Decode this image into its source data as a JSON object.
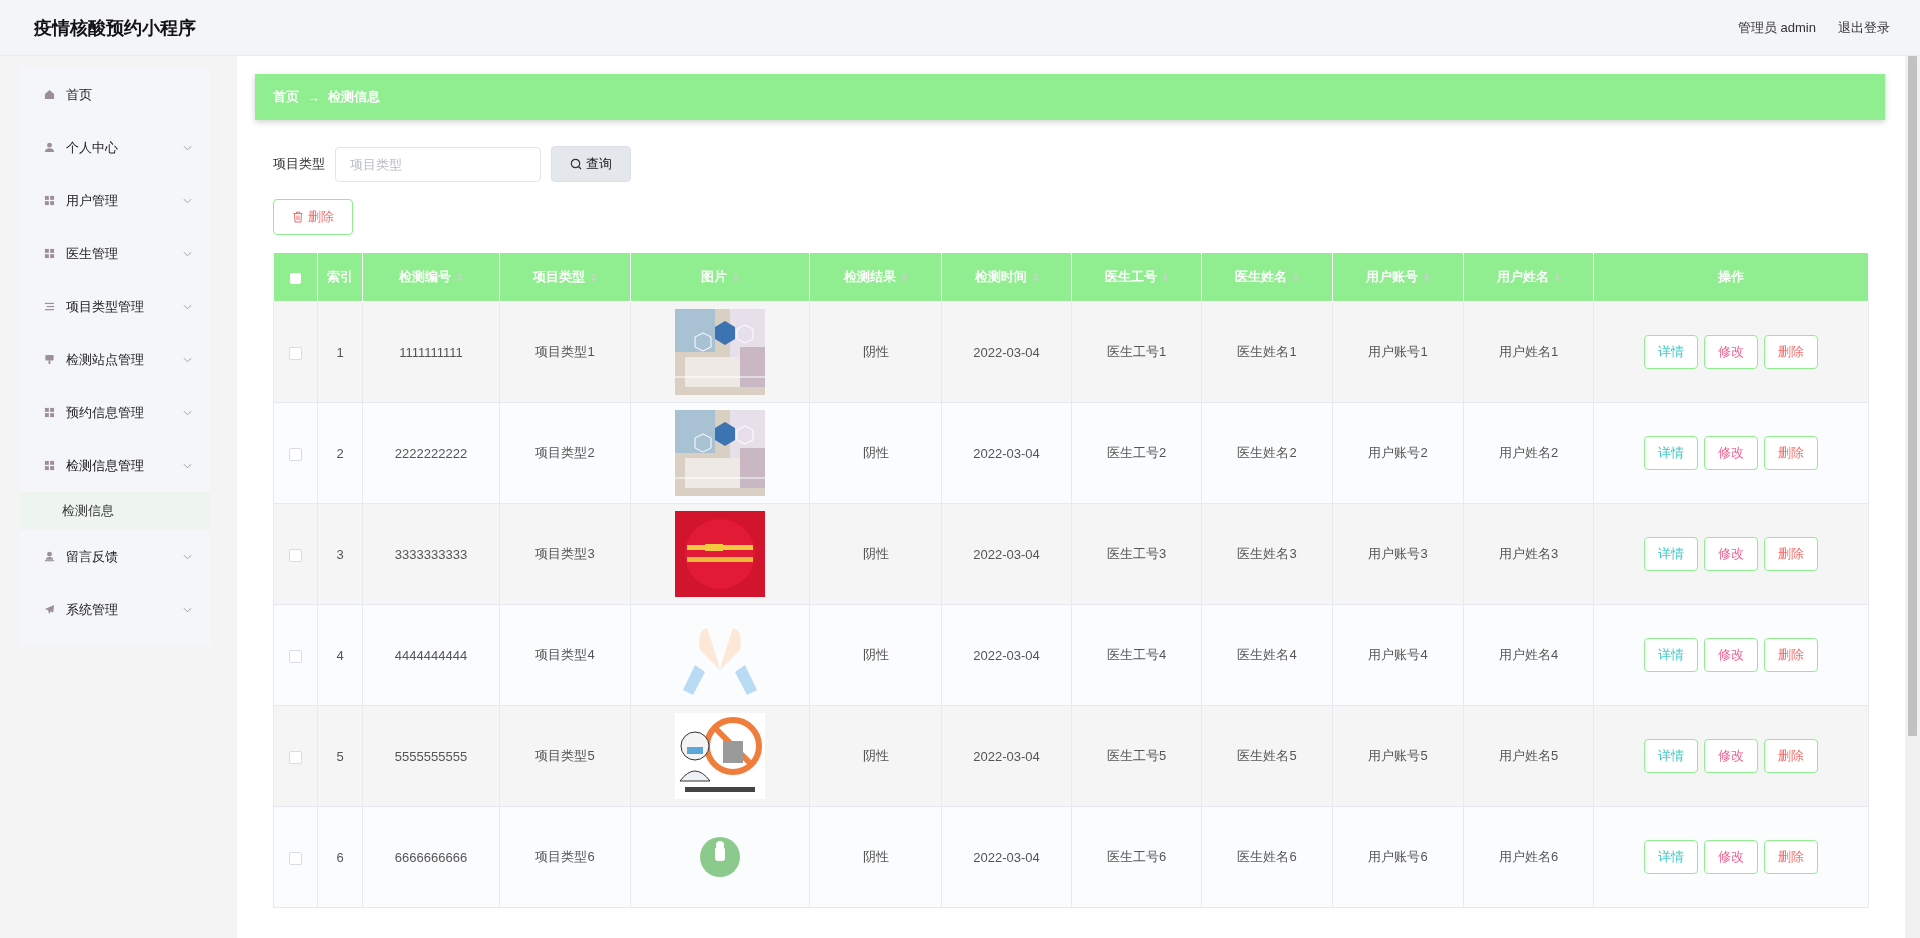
{
  "header": {
    "title": "疫情核酸预约小程序",
    "user": "管理员 admin",
    "logout": "退出登录"
  },
  "sidebar": {
    "items": [
      {
        "label": "首页",
        "kind": "link",
        "expanded": false
      },
      {
        "label": "个人中心",
        "kind": "submenu",
        "expanded": false
      },
      {
        "label": "用户管理",
        "kind": "submenu",
        "expanded": false
      },
      {
        "label": "医生管理",
        "kind": "submenu",
        "expanded": false
      },
      {
        "label": "项目类型管理",
        "kind": "submenu",
        "expanded": false
      },
      {
        "label": "检测站点管理",
        "kind": "submenu",
        "expanded": false
      },
      {
        "label": "预约信息管理",
        "kind": "submenu",
        "expanded": false
      },
      {
        "label": "检测信息管理",
        "kind": "submenu",
        "expanded": true,
        "children": [
          {
            "label": "检测信息",
            "selected": true
          }
        ]
      },
      {
        "label": "留言反馈",
        "kind": "submenu",
        "expanded": false
      },
      {
        "label": "系统管理",
        "kind": "submenu",
        "expanded": false
      }
    ]
  },
  "breadcrumb": [
    "首页",
    "→",
    "检测信息"
  ],
  "search": {
    "label": "项目类型",
    "placeholder": "项目类型",
    "button": "查询"
  },
  "delete_button": "删除",
  "table": {
    "all_selected": false,
    "columns": [
      {
        "label": "索引",
        "sortable": false
      },
      {
        "label": "检测编号",
        "sortable": true
      },
      {
        "label": "项目类型",
        "sortable": true
      },
      {
        "label": "图片",
        "sortable": true
      },
      {
        "label": "检测结果",
        "sortable": true
      },
      {
        "label": "检测时间",
        "sortable": true
      },
      {
        "label": "医生工号",
        "sortable": true
      },
      {
        "label": "医生姓名",
        "sortable": true
      },
      {
        "label": "用户账号",
        "sortable": true
      },
      {
        "label": "用户姓名",
        "sortable": true
      },
      {
        "label": "操作",
        "sortable": false
      }
    ],
    "rows": [
      {
        "selected": false,
        "index": "1",
        "code": "1111111111",
        "type": "项目类型1",
        "result": "阴性",
        "time": "2022-03-04",
        "doctor_no": "医生工号1",
        "doctor_name": "医生姓名1",
        "account": "用户账号1",
        "user_name": "用户姓名1",
        "actions": [
          {
            "label": "详情",
            "kind": "detail"
          },
          {
            "label": "修改",
            "kind": "edit"
          },
          {
            "label": "删除",
            "kind": "delete"
          }
        ]
      },
      {
        "selected": false,
        "index": "2",
        "code": "2222222222",
        "type": "项目类型2",
        "result": "阴性",
        "time": "2022-03-04",
        "doctor_no": "医生工号2",
        "doctor_name": "医生姓名2",
        "account": "用户账号2",
        "user_name": "用户姓名2",
        "actions": [
          {
            "label": "详情",
            "kind": "detail"
          },
          {
            "label": "修改",
            "kind": "edit"
          },
          {
            "label": "删除",
            "kind": "delete"
          }
        ]
      },
      {
        "selected": false,
        "index": "3",
        "code": "3333333333",
        "type": "项目类型3",
        "result": "阴性",
        "time": "2022-03-04",
        "doctor_no": "医生工号3",
        "doctor_name": "医生姓名3",
        "account": "用户账号3",
        "user_name": "用户姓名3",
        "actions": [
          {
            "label": "详情",
            "kind": "detail"
          },
          {
            "label": "修改",
            "kind": "edit"
          },
          {
            "label": "删除",
            "kind": "delete"
          }
        ]
      },
      {
        "selected": false,
        "index": "4",
        "code": "4444444444",
        "type": "项目类型4",
        "result": "阴性",
        "time": "2022-03-04",
        "doctor_no": "医生工号4",
        "doctor_name": "医生姓名4",
        "account": "用户账号4",
        "user_name": "用户姓名4",
        "actions": [
          {
            "label": "详情",
            "kind": "detail"
          },
          {
            "label": "修改",
            "kind": "edit"
          },
          {
            "label": "删除",
            "kind": "delete"
          }
        ]
      },
      {
        "selected": false,
        "index": "5",
        "code": "5555555555",
        "type": "项目类型5",
        "result": "阴性",
        "time": "2022-03-04",
        "doctor_no": "医生工号5",
        "doctor_name": "医生姓名5",
        "account": "用户账号5",
        "user_name": "用户姓名5",
        "actions": [
          {
            "label": "详情",
            "kind": "detail"
          },
          {
            "label": "修改",
            "kind": "edit"
          },
          {
            "label": "删除",
            "kind": "delete"
          }
        ]
      },
      {
        "selected": false,
        "index": "6",
        "code": "6666666666",
        "type": "项目类型6",
        "result": "阴性",
        "time": "2022-03-04",
        "doctor_no": "医生工号6",
        "doctor_name": "医生姓名6",
        "account": "用户账号6",
        "user_name": "用户姓名6",
        "actions": [
          {
            "label": "详情",
            "kind": "detail"
          },
          {
            "label": "修改",
            "kind": "edit"
          },
          {
            "label": "删除",
            "kind": "delete"
          }
        ]
      }
    ]
  }
}
